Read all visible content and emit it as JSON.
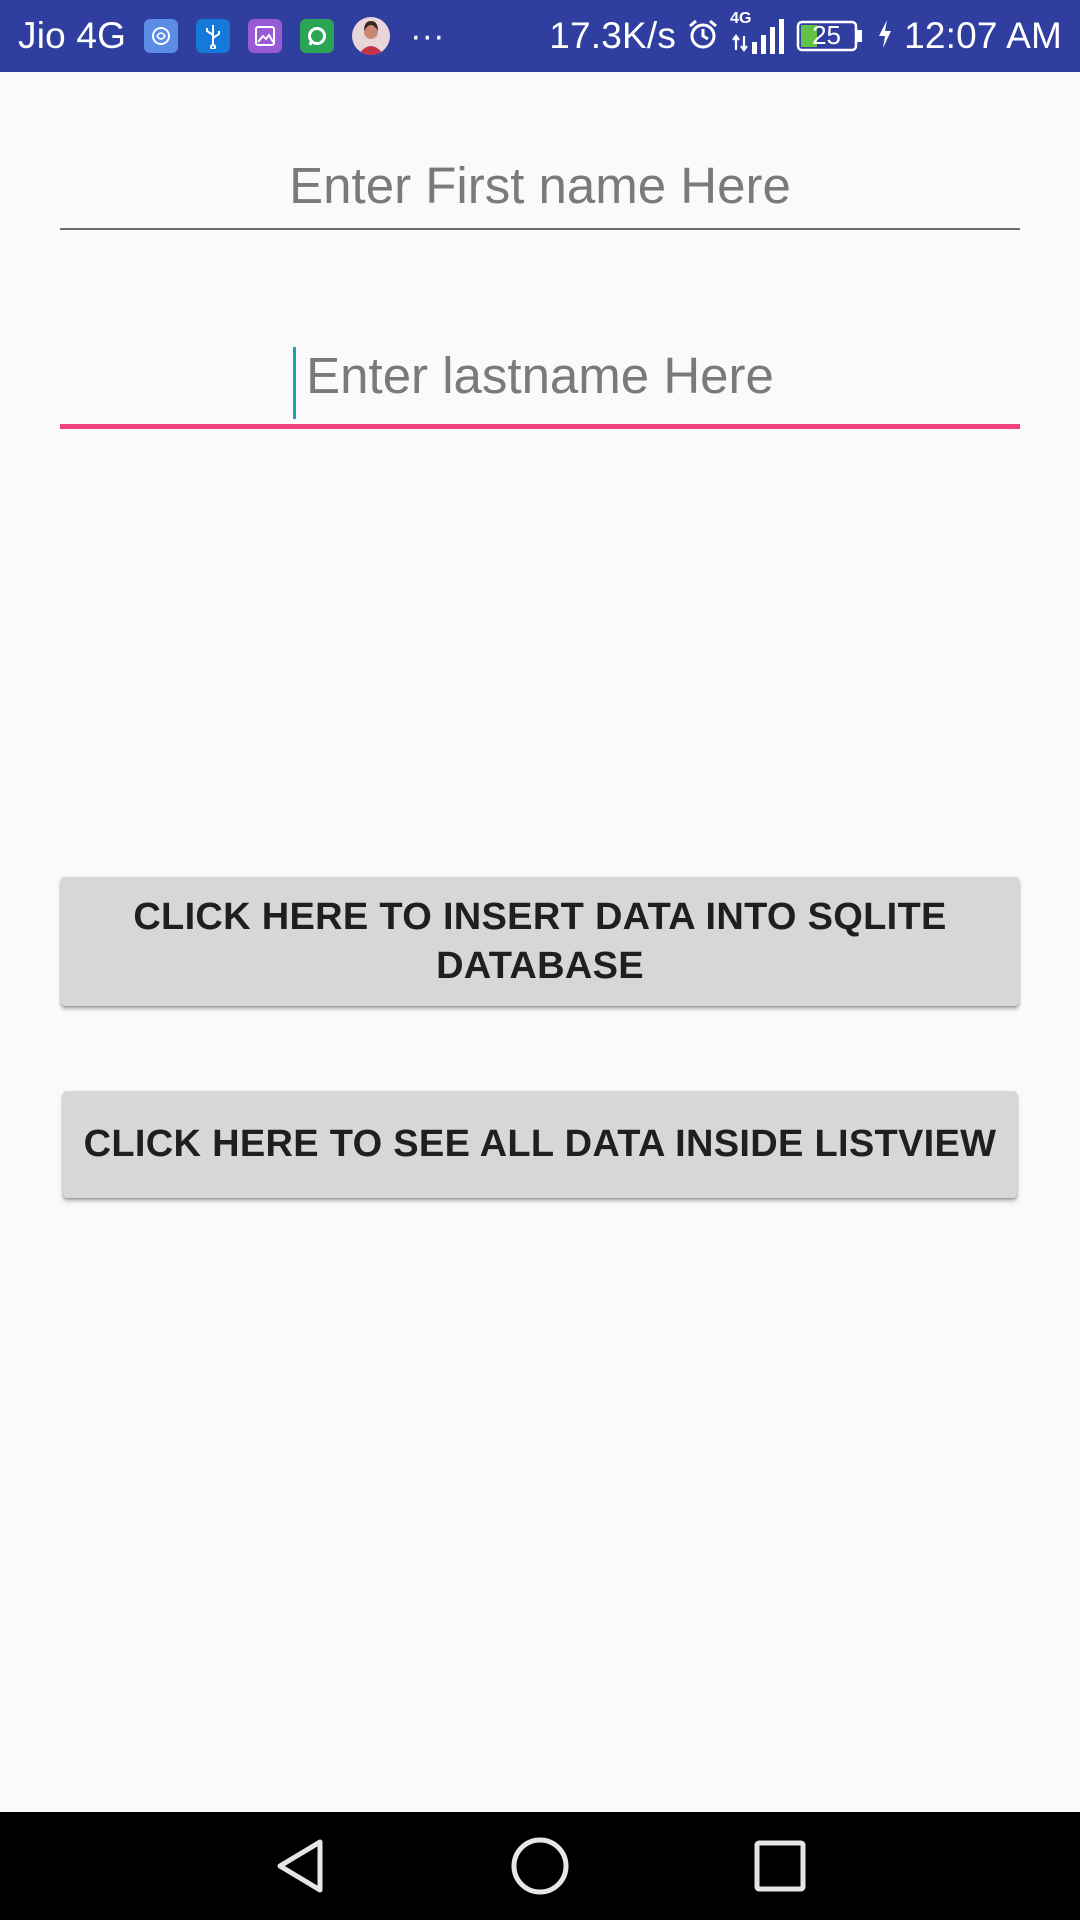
{
  "status_bar": {
    "carrier": "Jio 4G",
    "network_speed": "17.3K/s",
    "signal_label": "4G",
    "battery_level": "25",
    "time": "12:07 AM",
    "more_indicator": "···",
    "notification_icons": [
      "app-notification-icon",
      "usb-icon",
      "gallery-icon",
      "whatsapp-icon",
      "contact-avatar"
    ],
    "colors": {
      "background": "#303f9f",
      "foreground": "#ffffff"
    }
  },
  "form": {
    "first_name": {
      "placeholder": "Enter First name Here",
      "value": ""
    },
    "last_name": {
      "placeholder": "Enter lastname Here",
      "value": "",
      "focused": true
    }
  },
  "buttons": {
    "insert": {
      "label": "CLICK HERE TO INSERT DATA INTO SQLITE DATABASE"
    },
    "show": {
      "label": "CLICK HERE TO SEE ALL DATA INSIDE LISTVIEW"
    }
  },
  "navigation": {
    "icons": [
      "back-icon",
      "home-icon",
      "recents-icon"
    ]
  },
  "colors": {
    "background": "#fafafa",
    "accent": "#f0437c",
    "cursor": "#1ea1b5",
    "button": "#d7d7d7"
  }
}
